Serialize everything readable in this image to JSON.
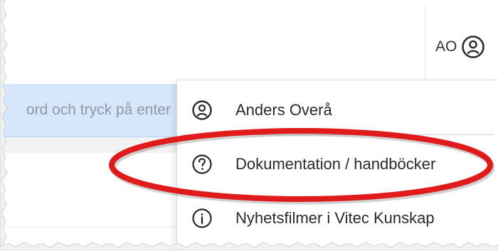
{
  "header": {
    "user_initials": "AO",
    "user_icon": "user-circle-icon"
  },
  "search": {
    "placeholder": "ord och tryck på enter"
  },
  "menu": {
    "items": [
      {
        "label": "Anders Overå",
        "icon": "user-circle-icon"
      },
      {
        "label": "Dokumentation / handböcker",
        "icon": "question-circle-icon"
      },
      {
        "label": "Nyhetsfilmer i Vitec Kunskap",
        "icon": "info-circle-icon"
      }
    ]
  },
  "colors": {
    "search_background": "#d6e6fb",
    "highlight_red": "#e01b1b"
  }
}
